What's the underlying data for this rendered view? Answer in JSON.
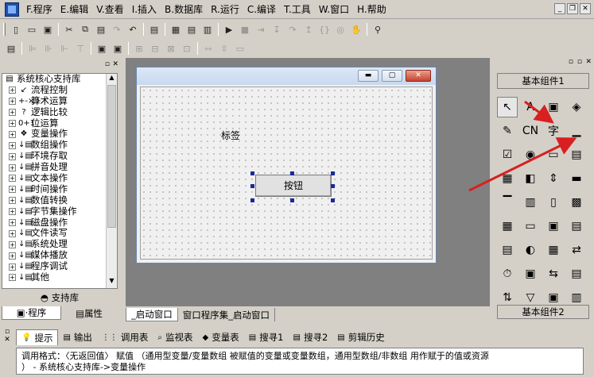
{
  "menu": [
    "F.程序",
    "E.编辑",
    "V.查看",
    "I.插入",
    "B.数据库",
    "R.运行",
    "C.编译",
    "T.工具",
    "W.窗口",
    "H.帮助"
  ],
  "tree": {
    "root": "系统核心支持库",
    "items": [
      {
        "icon": "↙",
        "label": "流程控制"
      },
      {
        "icon": "+-×÷",
        "label": "算术运算"
      },
      {
        "icon": "?",
        "label": "逻辑比较"
      },
      {
        "icon": "0+1",
        "label": "位运算"
      },
      {
        "icon": "❖",
        "label": "变量操作"
      },
      {
        "icon": "↓▤",
        "label": "数组操作"
      },
      {
        "icon": "↓▤",
        "label": "环境存取"
      },
      {
        "icon": "↓▤",
        "label": "拼音处理"
      },
      {
        "icon": "↓▤",
        "label": "文本操作"
      },
      {
        "icon": "↓▤",
        "label": "时间操作"
      },
      {
        "icon": "↓▤",
        "label": "数值转换"
      },
      {
        "icon": "↓▤",
        "label": "字节集操作"
      },
      {
        "icon": "↓▤",
        "label": "磁盘操作"
      },
      {
        "icon": "↓▤",
        "label": "文件读写"
      },
      {
        "icon": "↓▤",
        "label": "系统处理"
      },
      {
        "icon": "↓▤",
        "label": "媒体播放"
      },
      {
        "icon": "↓▤",
        "label": "程序调试"
      },
      {
        "icon": "↓▤",
        "label": "其他"
      }
    ],
    "footer": "支持库",
    "tabs": [
      "程序",
      "属性"
    ]
  },
  "designer": {
    "label_text": "标签",
    "button_text": "按钮",
    "tabs": [
      "_启动窗口",
      "窗口程序集_启动窗口"
    ]
  },
  "palette": {
    "header": "基本组件1",
    "footer": "基本组件2",
    "items": [
      "↖",
      "A",
      "▣",
      "◈",
      "✎",
      "CN",
      "字",
      "▁",
      "☑",
      "◉",
      "▭",
      "▤",
      "▦",
      "◧",
      "⇕",
      "▬",
      "▔",
      "▥",
      "▯",
      "▩",
      "▦",
      "▭",
      "▣",
      "▤",
      "▤",
      "◐",
      "▦",
      "⇄",
      "⏱",
      "▣",
      "⇆",
      "▤",
      "⇅",
      "▽",
      "▣",
      "▥"
    ]
  },
  "bottom": {
    "tabs": [
      "提示",
      "输出",
      "调用表",
      "监视表",
      "变量表",
      "搜寻1",
      "搜寻2",
      "剪辑历史"
    ],
    "status_line1": "调用格式：〈无返回值〉 赋值 （通用型变量/变量数组 被赋值的变量或变量数组，通用型数组/非数组 用作赋于的值或资源",
    "status_line2": "） - 系统核心支持库->变量操作"
  },
  "colors": {
    "accent": "#d82020",
    "selection_handle": "#1a2a9a"
  }
}
